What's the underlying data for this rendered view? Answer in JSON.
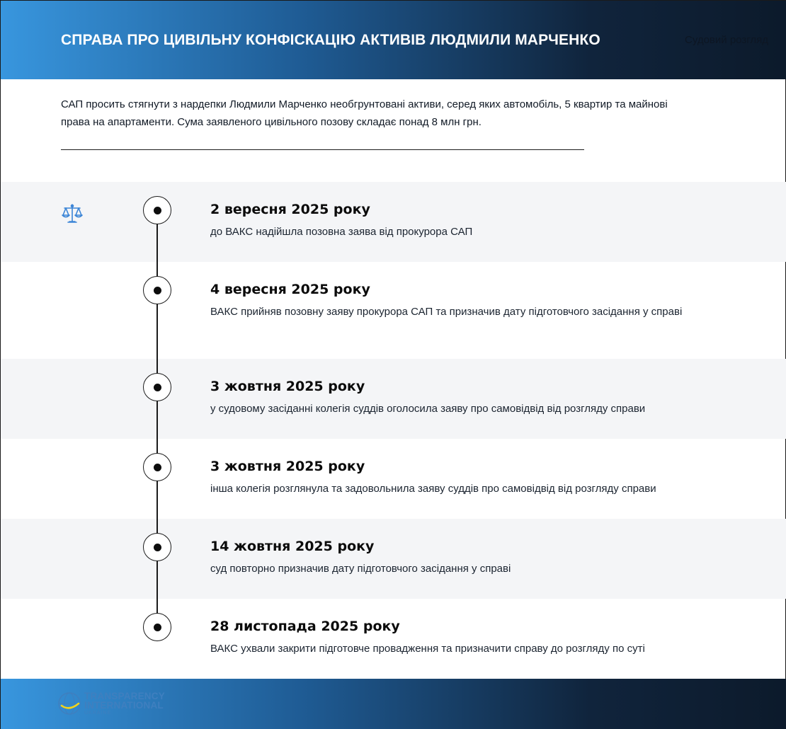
{
  "header": {
    "title": "Справа про цивільну конфіскацію активів Людмили Марченко",
    "tag": "Судовий розгляд"
  },
  "intro": {
    "text": "САП просить стягнути з нардепки Людмили Марченко необгрунтовані активи, серед яких автомобіль, 5 квартир та майнові права на апартаменти. Сума заявленого цивільного позову складає понад 8 млн грн."
  },
  "timeline": [
    {
      "date": "2 вересня 2025 року",
      "description": "до ВАКС надійшла позовна заява від прокурора САП"
    },
    {
      "date": "4 вересня 2025 року",
      "description": "ВАКС прийняв позовну заяву прокурора САП та призначив дату підготовчого засідання у справі"
    },
    {
      "date": "3 жовтня 2025 року",
      "description": "у судовому засіданні колегія суддів оголосила заяву про самовідвід від розгляду справи"
    },
    {
      "date": "3 жовтня 2025 року",
      "description": "інша колегія розглянула та задовольнила заяву суддів про самовідвід від розгляду справи"
    },
    {
      "date": "14 жовтня 2025 року",
      "description": "суд повторно призначив дату підготовчого засідання у справі"
    },
    {
      "date": "28 листопада 2025 року",
      "description": "ВАКС ухвали закрити підготовче провадження та призначити справу до розгляду по суті"
    }
  ],
  "footer": {
    "logo_line1": "TRANSPARENCY",
    "logo_line2": "INTERNATIONAL",
    "logo_line3": "UKRAINE"
  },
  "colors": {
    "header_gradient_start": "#3896de",
    "header_gradient_end": "#0c1a2b",
    "icon_blue": "#3a84d6",
    "row_shade": "#f4f5f7"
  },
  "icons": {
    "scale": "scale-of-justice-icon",
    "logo": "transparency-international-logo"
  }
}
